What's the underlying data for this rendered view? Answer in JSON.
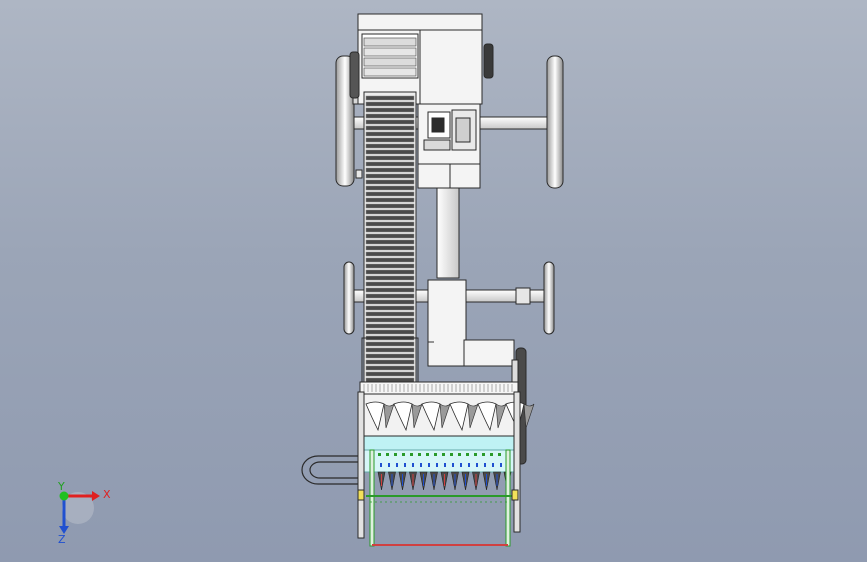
{
  "triad": {
    "x_label": "X",
    "y_label": "Y",
    "z_label": "Z",
    "colors": {
      "x": "#e02020",
      "y": "#20c020",
      "z": "#2050d0"
    }
  },
  "palette": {
    "background_top": "#aeb6c4",
    "background_bottom": "#8f9ab0",
    "part_fill": "#f4f4f4",
    "part_stroke": "#2a2a2a",
    "tooth_fill": "#4a4a4a",
    "screen_fill": "#bff2f4",
    "guide_green": "#2a9a2a",
    "guide_red": "#d04040"
  }
}
